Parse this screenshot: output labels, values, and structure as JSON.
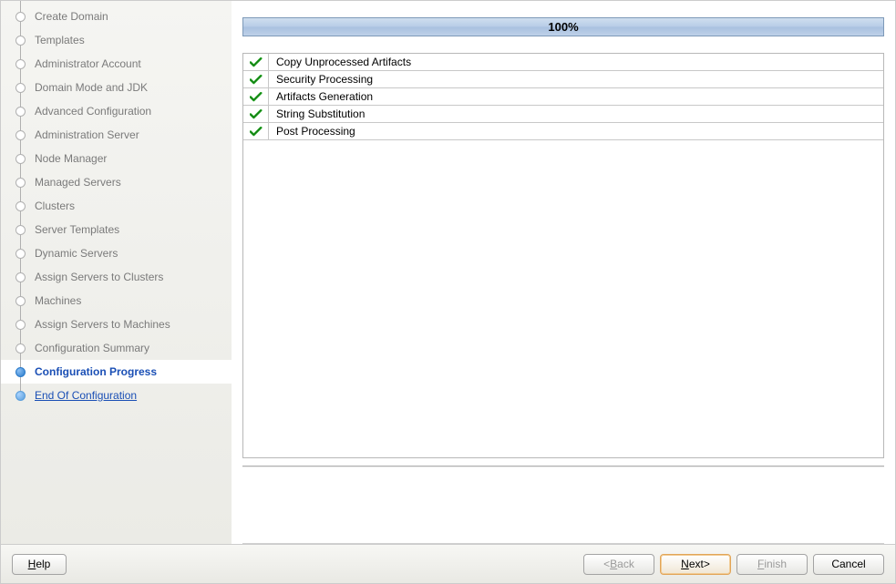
{
  "sidebar": {
    "items": [
      {
        "label": "Create Domain"
      },
      {
        "label": "Templates"
      },
      {
        "label": "Administrator Account"
      },
      {
        "label": "Domain Mode and JDK"
      },
      {
        "label": "Advanced Configuration"
      },
      {
        "label": "Administration Server"
      },
      {
        "label": "Node Manager"
      },
      {
        "label": "Managed Servers"
      },
      {
        "label": "Clusters"
      },
      {
        "label": "Server Templates"
      },
      {
        "label": "Dynamic Servers"
      },
      {
        "label": "Assign Servers to Clusters"
      },
      {
        "label": "Machines"
      },
      {
        "label": "Assign Servers to Machines"
      },
      {
        "label": "Configuration Summary"
      },
      {
        "label": "Configuration Progress"
      },
      {
        "label": "End Of Configuration"
      }
    ],
    "active_index": 15,
    "end_index": 16
  },
  "progress": {
    "percent_text": "100%",
    "percent_value": 100,
    "tasks": [
      {
        "label": "Copy Unprocessed Artifacts",
        "done": true
      },
      {
        "label": "Security Processing",
        "done": true
      },
      {
        "label": "Artifacts Generation",
        "done": true
      },
      {
        "label": "String Substitution",
        "done": true
      },
      {
        "label": "Post Processing",
        "done": true
      }
    ]
  },
  "footer": {
    "help": "Help",
    "back_prefix": "< ",
    "back_label": "Back",
    "next_label": "Next",
    "next_suffix": " >",
    "finish": "Finish",
    "cancel": "Cancel"
  }
}
